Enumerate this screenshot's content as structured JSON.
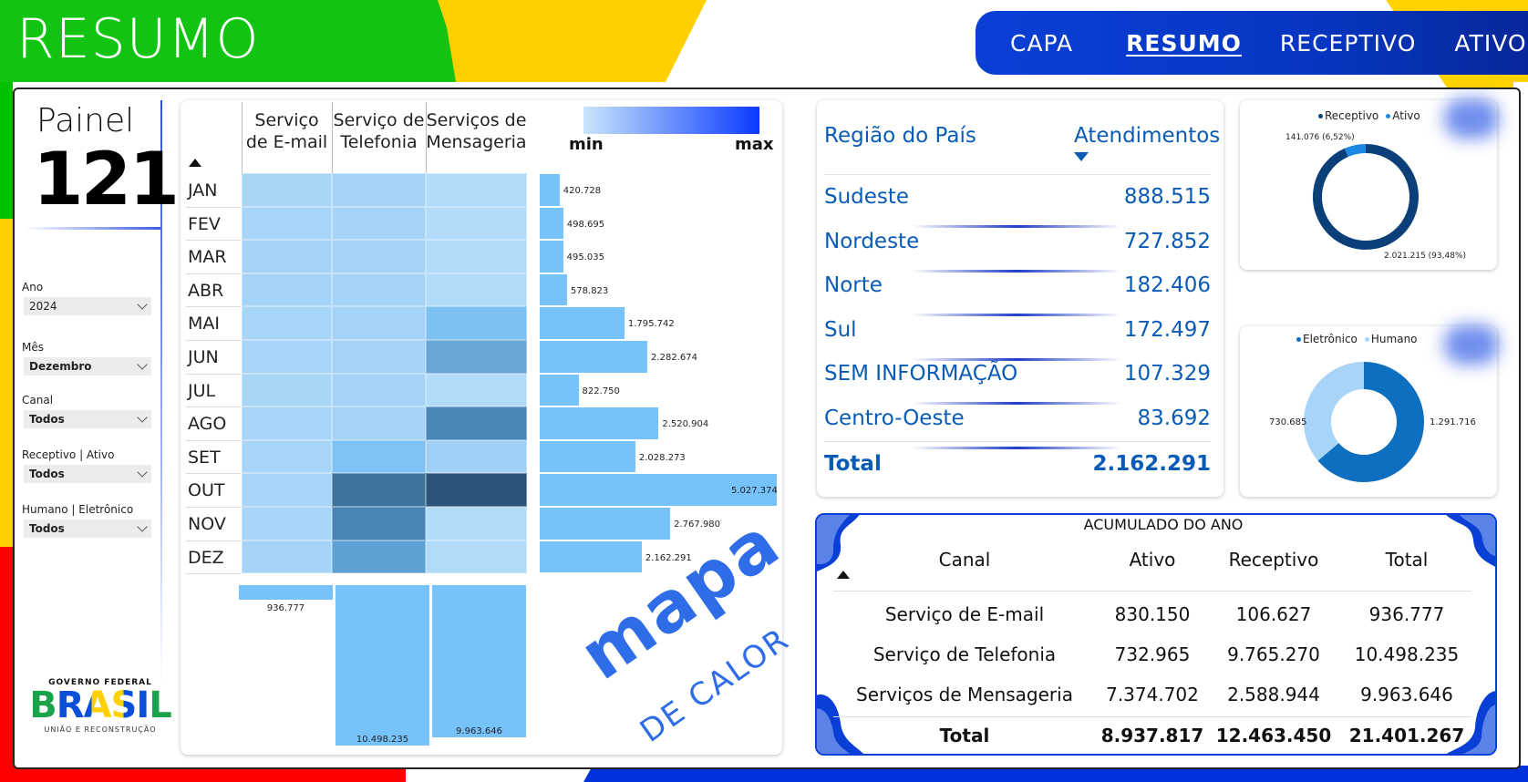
{
  "page": {
    "title": "RESUMO"
  },
  "nav": {
    "items": [
      "CAPA",
      "RESUMO",
      "RECEPTIVO",
      "ATIVO"
    ]
  },
  "painel": {
    "word": "Painel",
    "number": "121"
  },
  "filters": [
    {
      "label": "Ano",
      "value": "2024"
    },
    {
      "label": "Mês",
      "value": "Dezembro"
    },
    {
      "label": "Canal",
      "value": "Todos"
    },
    {
      "label": "Receptivo | Ativo",
      "value": "Todos"
    },
    {
      "label": "Humano | Eletrônico",
      "value": "Todos"
    }
  ],
  "logo": {
    "top": "GOVERNO FEDERAL",
    "main": "BRASIL",
    "bottom": "UNIÃO E RECONSTRUÇÃO"
  },
  "heatmap": {
    "columns": [
      "Serviço de E-mail",
      "Serviço de Telefonia",
      "Serviços de Mensageria"
    ],
    "scale": {
      "min_label": "min",
      "max_label": "max"
    },
    "months": [
      "JAN",
      "FEV",
      "MAR",
      "ABR",
      "MAI",
      "JUN",
      "JUL",
      "AGO",
      "SET",
      "OUT",
      "NOV",
      "DEZ"
    ],
    "cells": [
      [
        "#a9d6f7",
        "#a6d4f8",
        "#b0dbf9"
      ],
      [
        "#a7d5f8",
        "#a6d4f8",
        "#b0dbf9"
      ],
      [
        "#a6d4f8",
        "#a5d3f8",
        "#b0dbf9"
      ],
      [
        "#a6d4f8",
        "#a5d3f8",
        "#b0dbf9"
      ],
      [
        "#a7d5f8",
        "#a5d3f8",
        "#7dc1f3"
      ],
      [
        "#a7d5f8",
        "#a5d3f8",
        "#6aa6d6"
      ],
      [
        "#a9d6f7",
        "#a5d3f8",
        "#b0dbf9"
      ],
      [
        "#a7d5f8",
        "#a5d3f8",
        "#4a87b8"
      ],
      [
        "#a7d5f8",
        "#7dc2f5",
        "#a1d0f6"
      ],
      [
        "#a8d5f8",
        "#3e739c",
        "#2b5578"
      ],
      [
        "#a7d5f8",
        "#4a83b5",
        "#b0dbf9"
      ],
      [
        "#a6d4f8",
        "#5da0d4",
        "#b0dbf9"
      ]
    ],
    "month_totals": [
      "420.728",
      "498.695",
      "495.035",
      "578.823",
      "1.795.742",
      "2.282.674",
      "822.750",
      "2.520.904",
      "2.028.273",
      "5.027.374",
      "2.767.980",
      "2.162.291"
    ],
    "month_values": [
      420728,
      498695,
      495035,
      578823,
      1795742,
      2282674,
      822750,
      2520904,
      2028273,
      5027374,
      2767980,
      2162291
    ],
    "column_totals": [
      "936.777",
      "10.498.235",
      "9.963.646"
    ],
    "column_values": [
      936777,
      10498235,
      9963646
    ],
    "watermark_1": "mapa",
    "watermark_2": "DE CALOR"
  },
  "regions": {
    "head_region": "Região do País",
    "head_value": "Atendimentos",
    "rows": [
      {
        "name": "Sudeste",
        "value": "888.515"
      },
      {
        "name": "Nordeste",
        "value": "727.852"
      },
      {
        "name": "Norte",
        "value": "182.406"
      },
      {
        "name": "Sul",
        "value": "172.497"
      },
      {
        "name": "SEM INFORMAÇÃO",
        "value": "107.329"
      },
      {
        "name": "Centro-Oeste",
        "value": "83.692"
      }
    ],
    "total_label": "Total",
    "total_value": "2.162.291"
  },
  "donut1": {
    "legend": [
      "Receptivo",
      "Ativo"
    ],
    "colors": [
      "#0b3f7a",
      "#1e88e5"
    ],
    "values": [
      2021215,
      141076
    ],
    "labels": [
      "2.021.215 (93,48%)",
      "141.076 (6,52%)"
    ]
  },
  "donut2": {
    "legend": [
      "Eletrônico",
      "Humano"
    ],
    "colors": [
      "#0d6fc0",
      "#a8d4f7"
    ],
    "values": [
      1291716,
      730685
    ],
    "labels": [
      "1.291.716",
      "730.685"
    ]
  },
  "accumulated": {
    "title": "ACUMULADO DO ANO",
    "headers": [
      "Canal",
      "Ativo",
      "Receptivo",
      "Total"
    ],
    "rows": [
      [
        "Serviço de E-mail",
        "830.150",
        "106.627",
        "936.777"
      ],
      [
        "Serviço de Telefonia",
        "732.965",
        "9.765.270",
        "10.498.235"
      ],
      [
        "Serviços de Mensageria",
        "7.374.702",
        "2.588.944",
        "9.963.646"
      ]
    ],
    "total": [
      "Total",
      "8.937.817",
      "12.463.450",
      "21.401.267"
    ]
  }
}
